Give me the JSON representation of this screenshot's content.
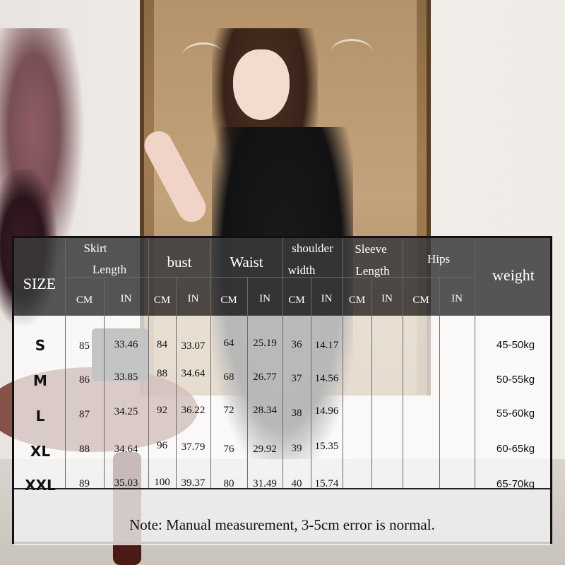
{
  "columns": {
    "size": "SIZE",
    "skirt_length": [
      "Skirt",
      "Length"
    ],
    "bust": "bust",
    "waist": "Waist",
    "shoulder_width": [
      "shoulder",
      "width"
    ],
    "sleeve_length": [
      "Sleeve",
      "Length"
    ],
    "hips": "Hips",
    "weight": "weight",
    "cm": "CM",
    "in": "IN"
  },
  "rows": [
    {
      "size": "S",
      "skirt_cm": "85",
      "skirt_in": "33.46",
      "bust_cm": "84",
      "bust_in": "33.07",
      "waist_cm": "64",
      "waist_in": "25.19",
      "shoulder_cm": "36",
      "shoulder_in": "14.17",
      "weight": "45-50kg"
    },
    {
      "size": "M",
      "skirt_cm": "86",
      "skirt_in": "33.85",
      "bust_cm": "88",
      "bust_in": "34.64",
      "waist_cm": "68",
      "waist_in": "26.77",
      "shoulder_cm": "37",
      "shoulder_in": "14.56",
      "weight": "50-55kg"
    },
    {
      "size": "L",
      "skirt_cm": "87",
      "skirt_in": "34.25",
      "bust_cm": "92",
      "bust_in": "36.22",
      "waist_cm": "72",
      "waist_in": "28.34",
      "shoulder_cm": "38",
      "shoulder_in": "14.96",
      "weight": "55-60kg"
    },
    {
      "size": "XL",
      "skirt_cm": "88",
      "skirt_in": "34.64",
      "bust_cm": "96",
      "bust_in": "37.79",
      "waist_cm": "76",
      "waist_in": "29.92",
      "shoulder_cm": "39",
      "shoulder_in": "15.35",
      "weight": "60-65kg"
    },
    {
      "size": "XXL",
      "skirt_cm": "89",
      "skirt_in": "35.03",
      "bust_cm": "100",
      "bust_in": "39.37",
      "waist_cm": "80",
      "waist_in": "31.49",
      "shoulder_cm": "40",
      "shoulder_in": "15.74",
      "weight": "65-70kg"
    }
  ],
  "note": "Note: Manual measurement, 3-5cm error is normal."
}
